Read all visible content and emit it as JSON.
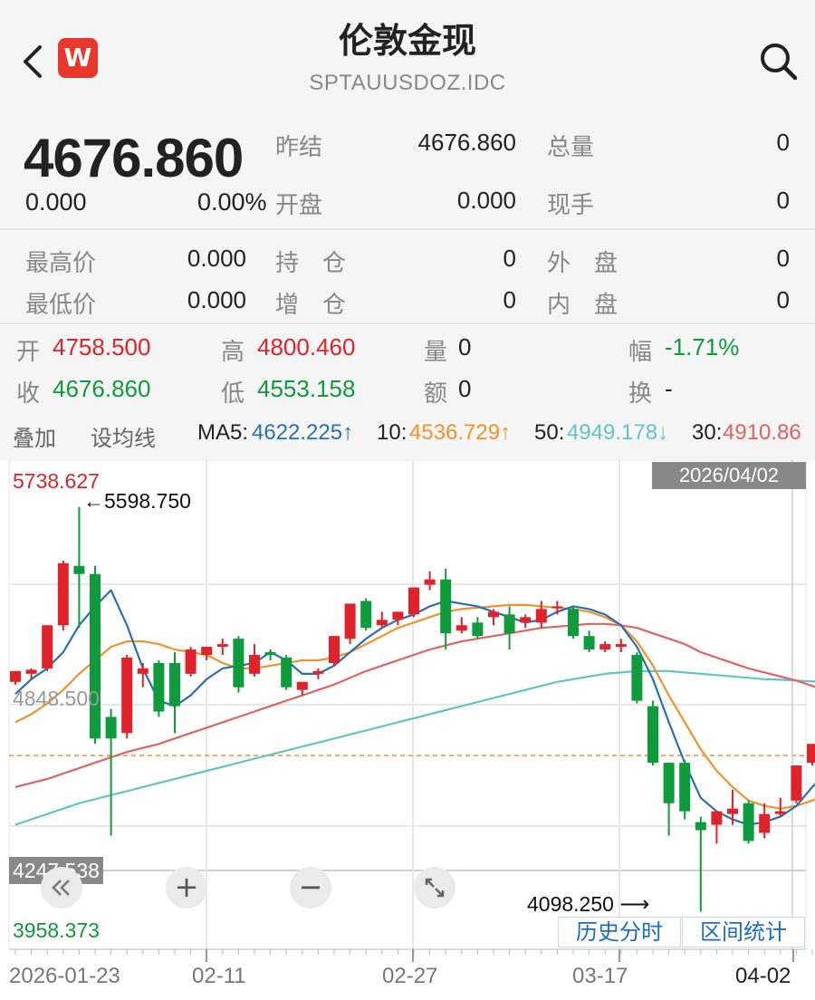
{
  "header": {
    "title": "伦敦金现",
    "code": "SPTAUUSDOZ.IDC",
    "logo_letter": "W",
    "back_icon": "back-arrow-icon",
    "search_icon": "search-icon"
  },
  "quote": {
    "price": "4676.860",
    "change": "0.000",
    "change_pct": "0.00%",
    "prev_close_label": "昨结",
    "prev_close": "4676.860",
    "total_vol_label": "总量",
    "total_vol": "0",
    "open_label": "开盘",
    "open": "0.000",
    "current_hand_label": "现手",
    "current_hand": "0",
    "high_label": "最高价",
    "high": "0.000",
    "hold_label": "持　仓",
    "hold": "0",
    "outer_label": "外　盘",
    "outer": "0",
    "low_label": "最低价",
    "low": "0.000",
    "add_label": "增　仓",
    "add": "0",
    "inner_label": "内　盘",
    "inner": "0"
  },
  "ohlc": {
    "open_label": "开",
    "open": "4758.500",
    "high_label": "高",
    "high": "4800.460",
    "vol_label": "量",
    "vol": "0",
    "range_label": "幅",
    "range": "-1.71%",
    "close_label": "收",
    "close": "4676.860",
    "low_label": "低",
    "low": "4553.158",
    "amount_label": "额",
    "amount": "0",
    "turnover_label": "换",
    "turnover": "-"
  },
  "toolbar": {
    "overlay": "叠加",
    "set_ma": "设均线",
    "ma5_label": "MA5:",
    "ma5": "4622.225↑",
    "ma10_label": "10:",
    "ma10": "4536.729↑",
    "ma50_label": "50:",
    "ma50": "4949.178↓",
    "ma30_label": "30:",
    "ma30": "4910.86"
  },
  "chart": {
    "date_badge": "2026/04/02",
    "y_top": "5738.627",
    "y_mid": "4848.500",
    "y_low_badge": "4247.538",
    "y_bottom": "3958.373",
    "max_note": "←5598.750",
    "min_note": "4098.250 ⟶",
    "x_labels": [
      "2026-01-23",
      "02-11",
      "02-27",
      "03-17",
      "04-02"
    ],
    "btn_history": "历史分时",
    "btn_range": "区间统计",
    "zoom_in": "+",
    "zoom_out": "−"
  },
  "chart_data": {
    "type": "candlestick",
    "x": [
      "2026-01-23",
      "02-11",
      "02-27",
      "03-17",
      "04-02"
    ],
    "ylim": [
      3958.373,
      5738.627
    ],
    "colors": {
      "up": "#e0222b",
      "down": "#0f9b3c",
      "ma5": "#2a6fb5",
      "ma10": "#f0932b",
      "ma30": "#e06363",
      "ma50": "#62c5c5"
    },
    "candles": [
      [
        4950,
        4990,
        4940,
        4990
      ],
      [
        4980,
        5000,
        4960,
        4995
      ],
      [
        5000,
        5160,
        4990,
        5160
      ],
      [
        5160,
        5400,
        5140,
        5390
      ],
      [
        5380,
        5598.75,
        5150,
        5350
      ],
      [
        5350,
        5380,
        4720,
        4740
      ],
      [
        4820,
        4850,
        4380,
        4740
      ],
      [
        4760,
        5050,
        4740,
        5040
      ],
      [
        4980,
        5020,
        4930,
        5000
      ],
      [
        5020,
        5030,
        4820,
        4840
      ],
      [
        5020,
        5060,
        4760,
        4860
      ],
      [
        4980,
        5080,
        4970,
        5070
      ],
      [
        5050,
        5080,
        5030,
        5080
      ],
      [
        5080,
        5110,
        5050,
        5090
      ],
      [
        5110,
        5120,
        4910,
        4930
      ],
      [
        4980,
        5090,
        4970,
        5050
      ],
      [
        5060,
        5070,
        5030,
        5050
      ],
      [
        5040,
        5050,
        4920,
        4930
      ],
      [
        4920,
        4950,
        4900,
        4950
      ],
      [
        4980,
        5000,
        4960,
        4990
      ],
      [
        5020,
        5120,
        5010,
        5120
      ],
      [
        5110,
        5240,
        5090,
        5240
      ],
      [
        5250,
        5260,
        5140,
        5150
      ],
      [
        5160,
        5210,
        5150,
        5180
      ],
      [
        5180,
        5210,
        5160,
        5210
      ],
      [
        5200,
        5300,
        5190,
        5300
      ],
      [
        5310,
        5360,
        5290,
        5330
      ],
      [
        5330,
        5370,
        5070,
        5130
      ],
      [
        5140,
        5190,
        5130,
        5160
      ],
      [
        5170,
        5190,
        5110,
        5120
      ],
      [
        5190,
        5220,
        5160,
        5210
      ],
      [
        5200,
        5230,
        5070,
        5130
      ],
      [
        5170,
        5200,
        5150,
        5190
      ],
      [
        5170,
        5250,
        5150,
        5220
      ],
      [
        5230,
        5250,
        5200,
        5230
      ],
      [
        5220,
        5230,
        5110,
        5120
      ],
      [
        5120,
        5140,
        5060,
        5070
      ],
      [
        5070,
        5100,
        5060,
        5090
      ],
      [
        5080,
        5110,
        5060,
        5090
      ],
      [
        5050,
        5060,
        4870,
        4880
      ],
      [
        4860,
        4880,
        4640,
        4650
      ],
      [
        4650,
        4650,
        4380,
        4500
      ],
      [
        4650,
        4660,
        4440,
        4470
      ],
      [
        4430,
        4450,
        4098.25,
        4400
      ],
      [
        4420,
        4470,
        4350,
        4470
      ],
      [
        4460,
        4550,
        4420,
        4480
      ],
      [
        4500,
        4510,
        4350,
        4360
      ],
      [
        4390,
        4500,
        4370,
        4460
      ],
      [
        4460,
        4520,
        4450,
        4470
      ],
      [
        4510,
        4640,
        4500,
        4640
      ],
      [
        4650,
        4720,
        4640,
        4720
      ],
      [
        4720,
        4720,
        4650,
        4660
      ]
    ],
    "ma5": [
      4905,
      4960,
      5000,
      5060,
      5160,
      5230,
      5290,
      5160,
      5000,
      4880,
      4860,
      4900,
      4960,
      5000,
      5010,
      5020,
      5060,
      5030,
      4980,
      4980,
      5010,
      5060,
      5110,
      5150,
      5180,
      5200,
      5230,
      5250,
      5240,
      5230,
      5210,
      5190,
      5170,
      5180,
      5210,
      5230,
      5220,
      5200,
      5160,
      5080,
      4960,
      4800,
      4650,
      4520,
      4470,
      4440,
      4420,
      4430,
      4450,
      4490,
      4560,
      4622
    ],
    "ma10": [
      4800,
      4830,
      4870,
      4920,
      4980,
      5030,
      5080,
      5100,
      5100,
      5090,
      5070,
      5060,
      5050,
      5020,
      5000,
      5000,
      5010,
      5020,
      5030,
      5030,
      5040,
      5060,
      5090,
      5120,
      5150,
      5170,
      5190,
      5210,
      5220,
      5225,
      5230,
      5235,
      5235,
      5230,
      5225,
      5220,
      5210,
      5190,
      5160,
      5100,
      5010,
      4900,
      4800,
      4700,
      4620,
      4560,
      4510,
      4490,
      4480,
      4490,
      4510,
      4536
    ],
    "ma30": [
      4560,
      4575,
      4590,
      4610,
      4630,
      4650,
      4670,
      4690,
      4705,
      4720,
      4740,
      4760,
      4780,
      4800,
      4820,
      4840,
      4860,
      4880,
      4900,
      4920,
      4940,
      4965,
      4990,
      5010,
      5030,
      5050,
      5070,
      5085,
      5100,
      5110,
      5120,
      5130,
      5140,
      5150,
      5155,
      5160,
      5165,
      5165,
      5160,
      5150,
      5130,
      5110,
      5090,
      5060,
      5040,
      5020,
      5000,
      4985,
      4970,
      4955,
      4935,
      4911
    ],
    "ma50": [
      4420,
      4440,
      4460,
      4480,
      4500,
      4515,
      4530,
      4545,
      4560,
      4575,
      4590,
      4605,
      4620,
      4635,
      4650,
      4665,
      4680,
      4695,
      4710,
      4725,
      4740,
      4755,
      4770,
      4785,
      4800,
      4815,
      4830,
      4845,
      4860,
      4875,
      4890,
      4905,
      4920,
      4935,
      4950,
      4960,
      4970,
      4980,
      4985,
      4990,
      4990,
      4990,
      4985,
      4980,
      4975,
      4970,
      4965,
      4960,
      4958,
      4955,
      4952,
      4949
    ]
  }
}
